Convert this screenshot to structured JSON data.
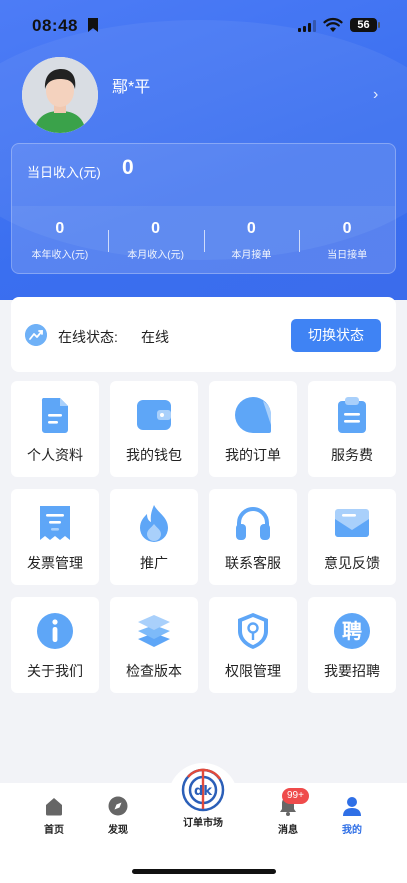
{
  "status_bar": {
    "time": "08:48",
    "battery": "56"
  },
  "profile": {
    "name": "鄢*平"
  },
  "income": {
    "today_label": "当日收入(元)",
    "today_value": "0",
    "stats": [
      {
        "value": "0",
        "label": "本年收入(元)"
      },
      {
        "value": "0",
        "label": "本月收入(元)"
      },
      {
        "value": "0",
        "label": "本月接单"
      },
      {
        "value": "0",
        "label": "当日接单"
      }
    ]
  },
  "online": {
    "label": "在线状态:",
    "value": "在线",
    "button": "切换状态"
  },
  "menu": [
    {
      "label": "个人资料",
      "icon": "document-icon"
    },
    {
      "label": "我的钱包",
      "icon": "wallet-icon"
    },
    {
      "label": "我的订单",
      "icon": "order-icon"
    },
    {
      "label": "服务费",
      "icon": "clipboard-icon"
    },
    {
      "label": "发票管理",
      "icon": "receipt-icon"
    },
    {
      "label": "推广",
      "icon": "flame-icon"
    },
    {
      "label": "联系客服",
      "icon": "headset-icon"
    },
    {
      "label": "意见反馈",
      "icon": "mail-icon"
    },
    {
      "label": "关于我们",
      "icon": "info-icon"
    },
    {
      "label": "检查版本",
      "icon": "layers-icon"
    },
    {
      "label": "权限管理",
      "icon": "shield-key-icon"
    },
    {
      "label": "我要招聘",
      "icon": "recruit-icon"
    }
  ],
  "recruit_glyph": "聘",
  "tabbar": {
    "home": "首页",
    "discover": "发现",
    "market": "订单市场",
    "messages": "消息",
    "messages_badge": "99+",
    "mine": "我的"
  },
  "colors": {
    "primary": "#3f83f4",
    "header": "#3b6cec",
    "badge": "#ef4b4b",
    "icon": "#5ea6f7"
  }
}
